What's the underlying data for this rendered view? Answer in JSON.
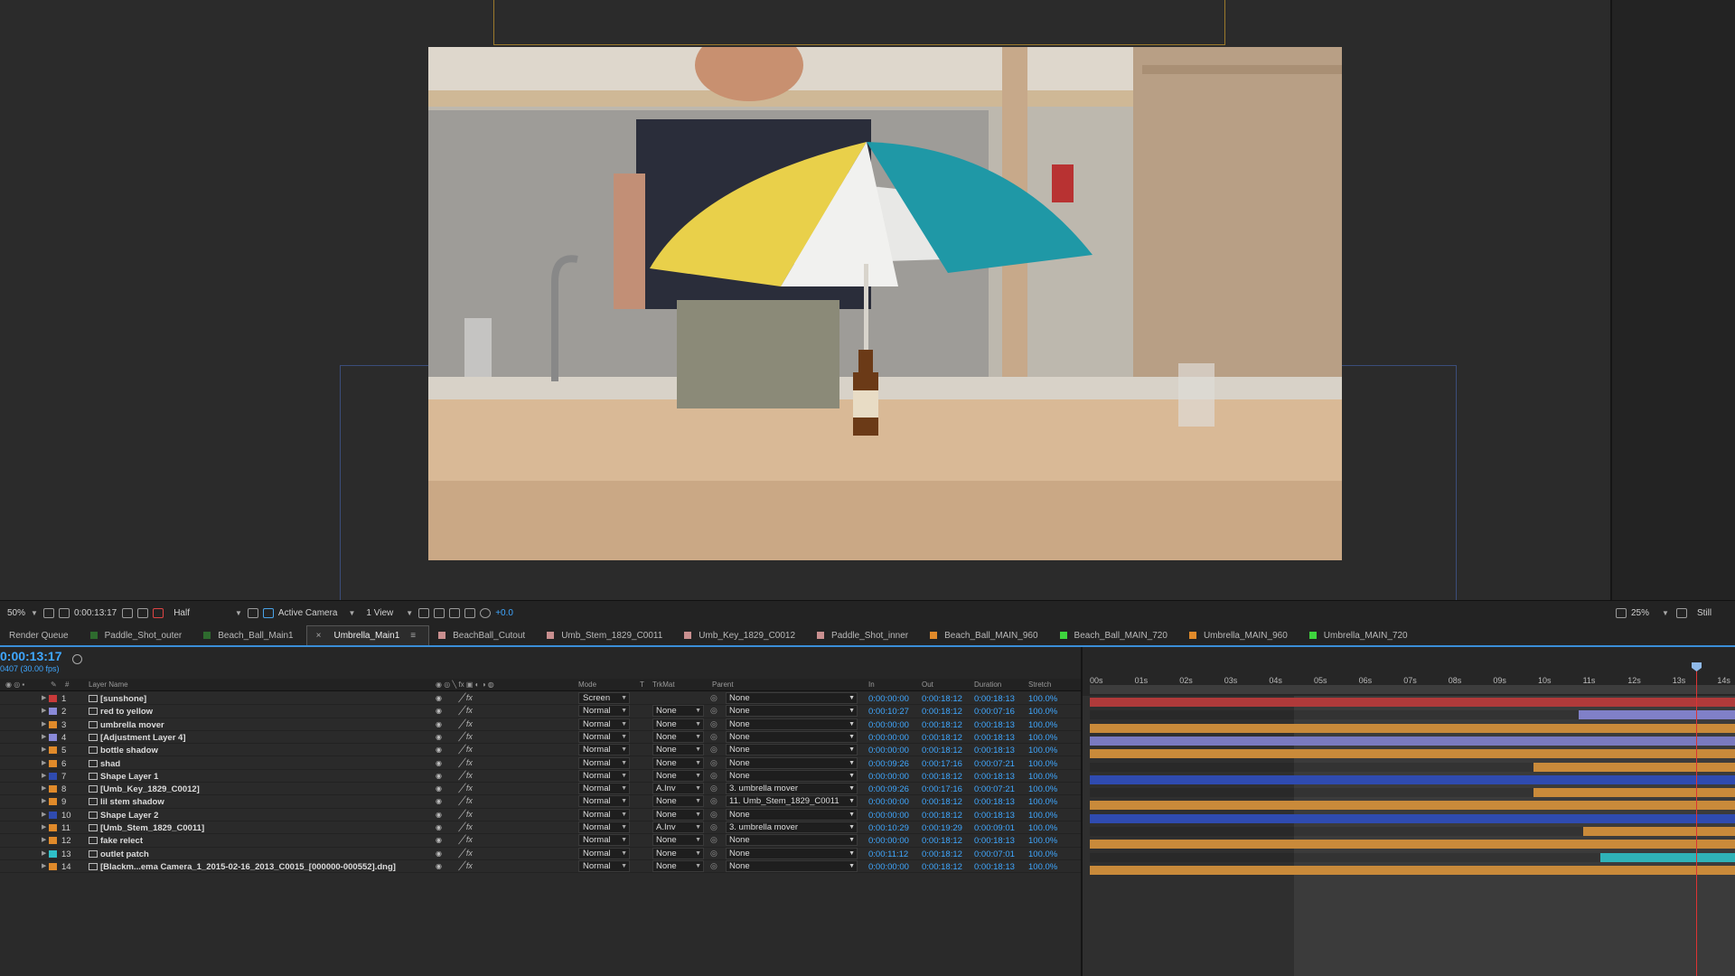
{
  "viewer": {
    "zoom": "50%",
    "time": "0:00:13:17",
    "resolution": "Half",
    "camera": "Active Camera",
    "views": "1 View",
    "exposure": "+0.0",
    "right_zoom": "25%",
    "right_label": "Still"
  },
  "tabs": [
    {
      "label": "Render Queue",
      "color": ""
    },
    {
      "label": "Paddle_Shot_outer",
      "color": "#2e6b2e"
    },
    {
      "label": "Beach_Ball_Main1",
      "color": "#2e6b2e"
    },
    {
      "label": "Umbrella_Main1",
      "color": "",
      "active": true
    },
    {
      "label": "BeachBall_Cutout",
      "color": "#c98f8f"
    },
    {
      "label": "Umb_Stem_1829_C0011",
      "color": "#c98f8f"
    },
    {
      "label": "Umb_Key_1829_C0012",
      "color": "#c98f8f"
    },
    {
      "label": "Paddle_Shot_inner",
      "color": "#c98f8f"
    },
    {
      "label": "Beach_Ball_MAIN_960",
      "color": "#e08a2a"
    },
    {
      "label": "Beach_Ball_MAIN_720",
      "color": "#3ed43e"
    },
    {
      "label": "Umbrella_MAIN_960",
      "color": "#e08a2a"
    },
    {
      "label": "Umbrella_MAIN_720",
      "color": "#3ed43e"
    }
  ],
  "timeline": {
    "current_time": "0:00:13:17",
    "frame_info": "0407 (30.00 fps)",
    "headers": {
      "layer_name": "Layer Name",
      "mode": "Mode",
      "t": "T",
      "trkmat": "TrkMat",
      "parent": "Parent",
      "in": "In",
      "out": "Out",
      "duration": "Duration",
      "stretch": "Stretch"
    },
    "ruler": [
      "00s",
      "01s",
      "02s",
      "03s",
      "04s",
      "05s",
      "06s",
      "07s",
      "08s",
      "09s",
      "10s",
      "11s",
      "12s",
      "13s",
      "14s"
    ],
    "layers": [
      {
        "num": "1",
        "name": "[sunshone]",
        "label": "#c83a3a",
        "mode": "Screen",
        "trkmat": "",
        "parent": "None",
        "in": "0:00:00:00",
        "out": "0:00:18:12",
        "duration": "0:00:18:13",
        "stretch": "100.0%",
        "bar_color": "#b03a3a",
        "bar_start": 0
      },
      {
        "num": "2",
        "name": "red to yellow",
        "label": "#8a8ad8",
        "mode": "Normal",
        "trkmat": "None",
        "parent": "None",
        "in": "0:00:10:27",
        "out": "0:00:18:12",
        "duration": "0:00:07:16",
        "stretch": "100.0%",
        "bar_color": "#8080c8",
        "bar_start": 10.9
      },
      {
        "num": "3",
        "name": "umbrella mover",
        "label": "#e08a2a",
        "mode": "Normal",
        "trkmat": "None",
        "parent": "None",
        "in": "0:00:00:00",
        "out": "0:00:18:12",
        "duration": "0:00:18:13",
        "stretch": "100.0%",
        "bar_color": "#c98a3a",
        "bar_start": 0
      },
      {
        "num": "4",
        "name": "[Adjustment Layer 4]",
        "label": "#8a8ad8",
        "mode": "Normal",
        "trkmat": "None",
        "parent": "None",
        "in": "0:00:00:00",
        "out": "0:00:18:12",
        "duration": "0:00:18:13",
        "stretch": "100.0%",
        "bar_color": "#7a7abf",
        "bar_start": 0
      },
      {
        "num": "5",
        "name": "bottle shadow",
        "label": "#e08a2a",
        "mode": "Normal",
        "trkmat": "None",
        "parent": "None",
        "in": "0:00:00:00",
        "out": "0:00:18:12",
        "duration": "0:00:18:13",
        "stretch": "100.0%",
        "bar_color": "#c98a3a",
        "bar_start": 0
      },
      {
        "num": "6",
        "name": "shad",
        "label": "#e08a2a",
        "mode": "Normal",
        "trkmat": "None",
        "parent": "None",
        "in": "0:00:09:26",
        "out": "0:00:17:16",
        "duration": "0:00:07:21",
        "stretch": "100.0%",
        "bar_color": "#c98a3a",
        "bar_start": 9.9
      },
      {
        "num": "7",
        "name": "Shape Layer 1",
        "label": "#2f4bb0",
        "mode": "Normal",
        "trkmat": "None",
        "parent": "None",
        "in": "0:00:00:00",
        "out": "0:00:18:12",
        "duration": "0:00:18:13",
        "stretch": "100.0%",
        "bar_color": "#2f4bb0",
        "bar_start": 0
      },
      {
        "num": "8",
        "name": "[Umb_Key_1829_C0012]",
        "label": "#e08a2a",
        "mode": "Normal",
        "trkmat": "A.Inv",
        "parent": "3. umbrella mover",
        "in": "0:00:09:26",
        "out": "0:00:17:16",
        "duration": "0:00:07:21",
        "stretch": "100.0%",
        "bar_color": "#c98a3a",
        "bar_start": 9.9
      },
      {
        "num": "9",
        "name": "lil stem shadow",
        "label": "#e08a2a",
        "mode": "Normal",
        "trkmat": "None",
        "parent": "11. Umb_Stem_1829_C0011",
        "in": "0:00:00:00",
        "out": "0:00:18:12",
        "duration": "0:00:18:13",
        "stretch": "100.0%",
        "bar_color": "#c98a3a",
        "bar_start": 0
      },
      {
        "num": "10",
        "name": "Shape Layer 2",
        "label": "#2f4bb0",
        "mode": "Normal",
        "trkmat": "None",
        "parent": "None",
        "in": "0:00:00:00",
        "out": "0:00:18:12",
        "duration": "0:00:18:13",
        "stretch": "100.0%",
        "bar_color": "#2f4bb0",
        "bar_start": 0
      },
      {
        "num": "11",
        "name": "[Umb_Stem_1829_C0011]",
        "label": "#e08a2a",
        "mode": "Normal",
        "trkmat": "A.Inv",
        "parent": "3. umbrella mover",
        "in": "0:00:10:29",
        "out": "0:00:19:29",
        "duration": "0:00:09:01",
        "stretch": "100.0%",
        "bar_color": "#c98a3a",
        "bar_start": 11.0
      },
      {
        "num": "12",
        "name": "fake relect",
        "label": "#e08a2a",
        "mode": "Normal",
        "trkmat": "None",
        "parent": "None",
        "in": "0:00:00:00",
        "out": "0:00:18:12",
        "duration": "0:00:18:13",
        "stretch": "100.0%",
        "bar_color": "#c98a3a",
        "bar_start": 0
      },
      {
        "num": "13",
        "name": "outlet patch",
        "label": "#2fc0c8",
        "mode": "Normal",
        "trkmat": "None",
        "parent": "None",
        "in": "0:00:11:12",
        "out": "0:00:18:12",
        "duration": "0:00:07:01",
        "stretch": "100.0%",
        "bar_color": "#2fb3b8",
        "bar_start": 11.4
      },
      {
        "num": "14",
        "name": "[Blackm...ema Camera_1_2015-02-16_2013_C0015_[000000-000552].dng]",
        "label": "#e08a2a",
        "mode": "Normal",
        "trkmat": "None",
        "parent": "None",
        "in": "0:00:00:00",
        "out": "0:00:18:12",
        "duration": "0:00:18:13",
        "stretch": "100.0%",
        "bar_color": "#c98a3a",
        "bar_start": 0
      }
    ]
  }
}
